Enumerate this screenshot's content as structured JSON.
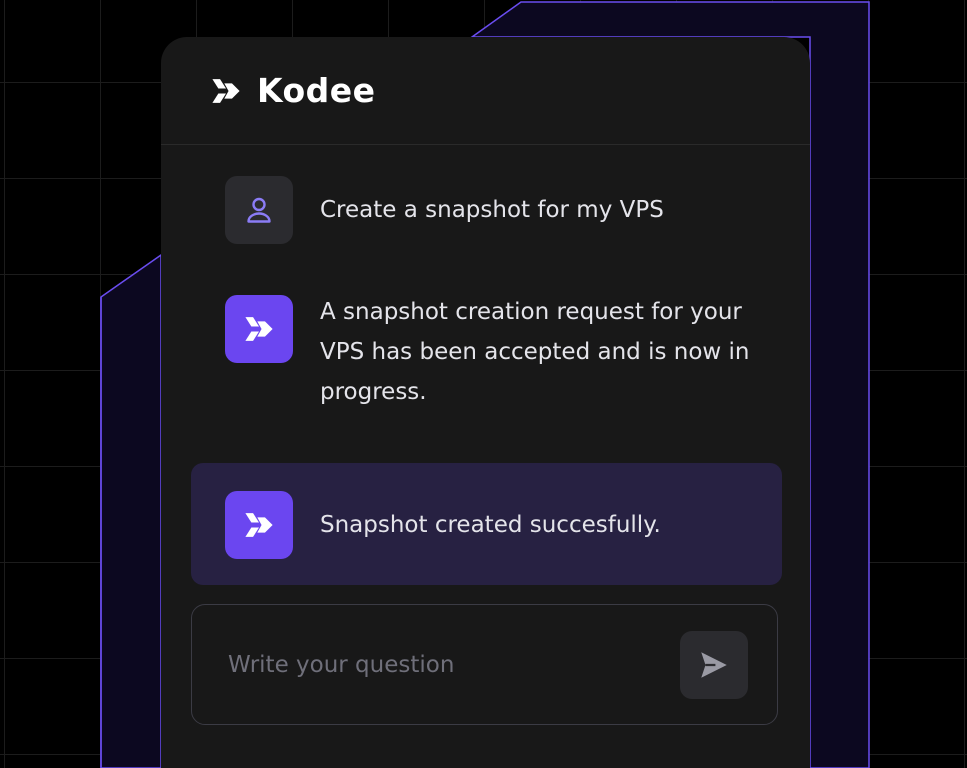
{
  "brand": {
    "name": "Kodee",
    "accent_color": "#6b46f0",
    "logo_icon": "kodee-logo-icon"
  },
  "messages": [
    {
      "role": "user",
      "icon": "user-icon",
      "text": "Create a snapshot for my VPS"
    },
    {
      "role": "assistant",
      "icon": "kodee-logo-icon",
      "text": "A snapshot creation request for your VPS has been accepted and is now in progress."
    },
    {
      "role": "assistant",
      "icon": "kodee-logo-icon",
      "text": "Snapshot created succesfully.",
      "highlighted": true
    }
  ],
  "composer": {
    "placeholder": "Write your question",
    "value": "",
    "send_icon": "send-icon"
  },
  "colors": {
    "background": "#000000",
    "card": "#181818",
    "highlight": "#272142",
    "panel_border": "#6a4df0"
  }
}
